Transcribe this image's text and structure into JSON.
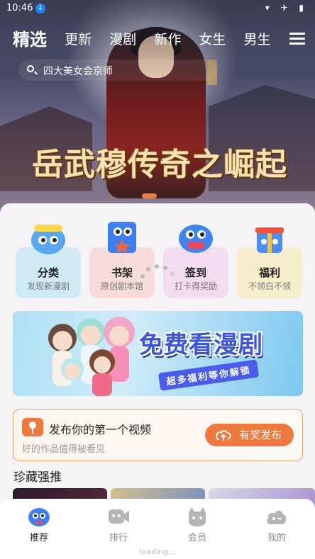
{
  "status_bar": {
    "time": "10:46",
    "icons": "▾ ✈ ▮"
  },
  "top_tabs": [
    {
      "label": "精选",
      "active": true
    },
    {
      "label": "更新"
    },
    {
      "label": "漫剧"
    },
    {
      "label": "新作"
    },
    {
      "label": "女生"
    },
    {
      "label": "男生"
    }
  ],
  "search": {
    "placeholder": "四大美女会京师"
  },
  "banner": {
    "title": "岳武穆传奇之崛起",
    "accent": "#f27a3a"
  },
  "quick_entries": [
    {
      "label": "分类",
      "sub": "发现新漫剧",
      "icon": "blue-mascot-icon",
      "plate": "#cfeaf5"
    },
    {
      "label": "书架",
      "sub": "原创剧本馆",
      "icon": "bookshelf-mascot-icon",
      "plate": "#f8dcdc"
    },
    {
      "label": "签到",
      "sub": "打卡得奖励",
      "icon": "checkin-mascot-icon",
      "plate": "#f3dcef"
    },
    {
      "label": "福利",
      "sub": "不领白不领",
      "icon": "gift-mascot-icon",
      "plate": "#f7efcc"
    }
  ],
  "promo": {
    "title": "免费看漫剧",
    "ribbon": "超多福利等你解锁"
  },
  "publish": {
    "title": "发布你的第一个视频",
    "sub": "好的作品值得被看见",
    "button": "有奖发布",
    "accent": "#f07a3e"
  },
  "section": {
    "title": "珍藏强推"
  },
  "bottom_nav": [
    {
      "label": "推荐",
      "active": true,
      "icon": "recommend-mascot-icon"
    },
    {
      "label": "排行",
      "icon": "ranking-icon"
    },
    {
      "label": "会员",
      "icon": "member-cat-icon"
    },
    {
      "label": "我的",
      "icon": "profile-cloud-icon"
    }
  ],
  "loading_text": "loading..."
}
